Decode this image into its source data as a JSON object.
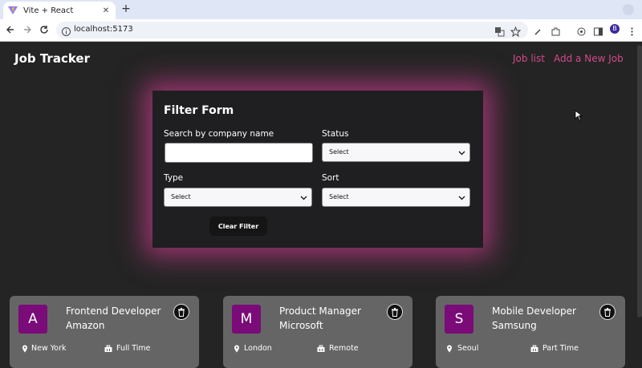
{
  "browser": {
    "tab_title": "Vite + React",
    "tab_close": "✕",
    "new_tab": "+",
    "url": "localhost:5173",
    "profile_initial": "B"
  },
  "app": {
    "brand": "Job Tracker",
    "nav": [
      "Job list",
      "Add a New Job"
    ],
    "accent_color": "#d2498a"
  },
  "filter": {
    "title": "Filter Form",
    "search_label": "Search by company name",
    "search_value": "",
    "status_label": "Status",
    "status_value": "Select",
    "type_label": "Type",
    "type_value": "Select",
    "sort_label": "Sort",
    "sort_value": "Select",
    "clear_label": "Clear Filter"
  },
  "jobs": [
    {
      "initial": "A",
      "title": "Frontend Developer",
      "company": "Amazon",
      "location": "New York",
      "type": "Full Time"
    },
    {
      "initial": "M",
      "title": "Product Manager",
      "company": "Microsoft",
      "location": "London",
      "type": "Remote"
    },
    {
      "initial": "S",
      "title": "Mobile Developer",
      "company": "Samsung",
      "location": "Seoul",
      "type": "Part Time"
    }
  ]
}
